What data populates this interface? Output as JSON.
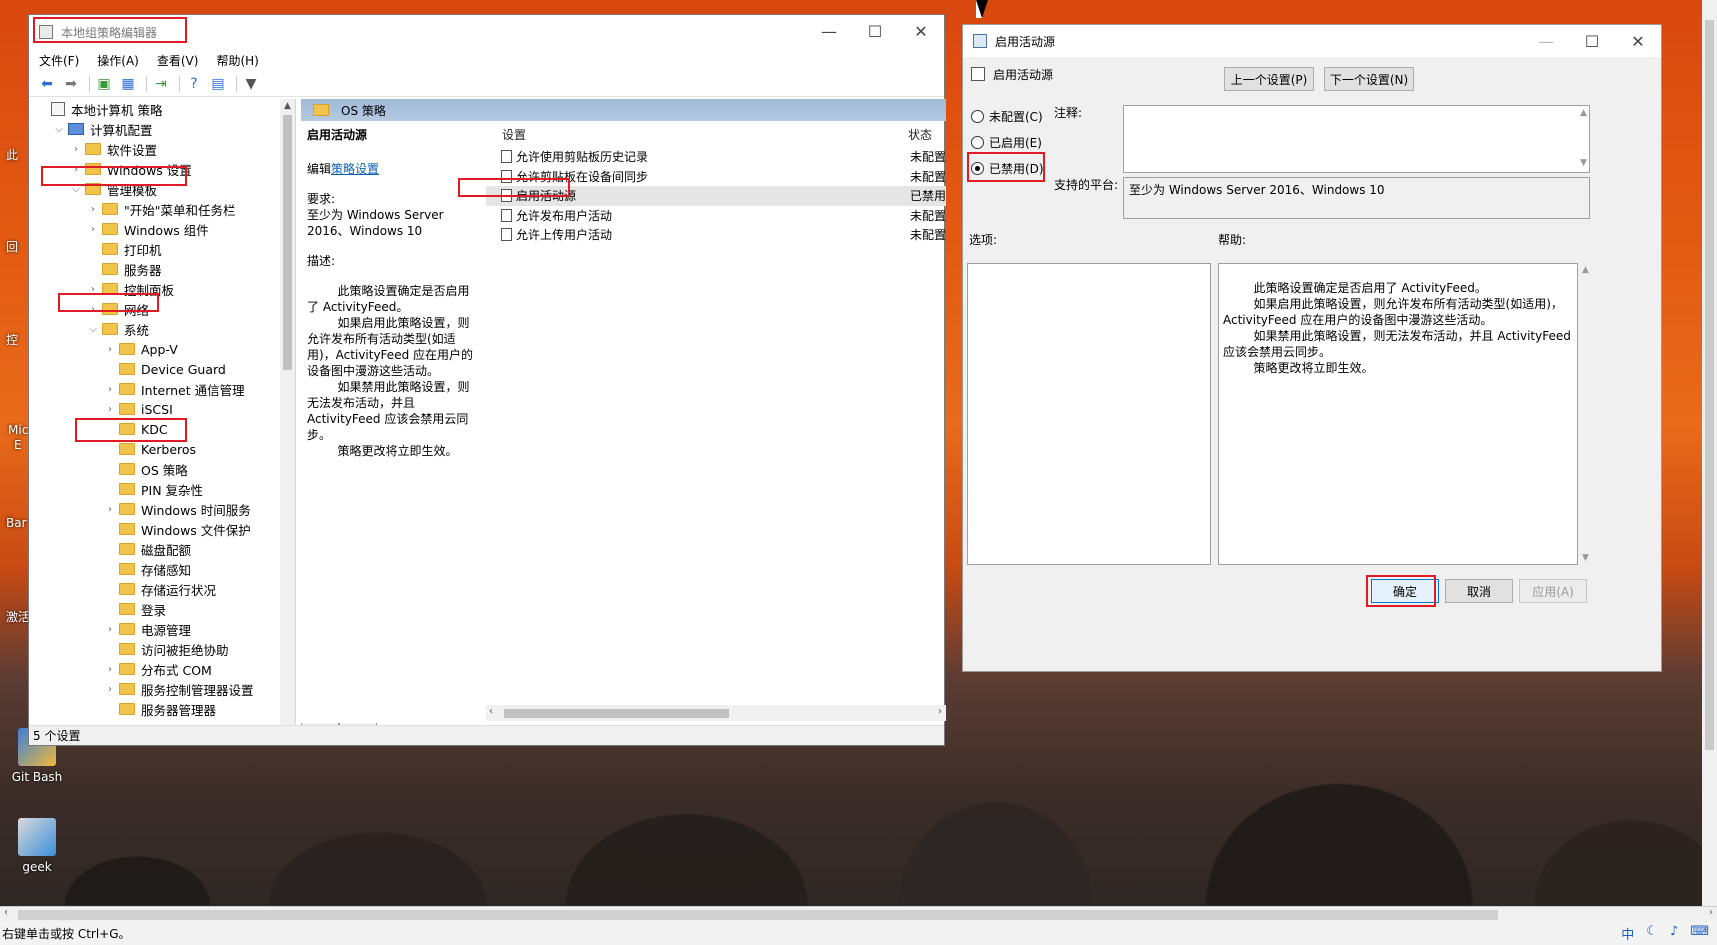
{
  "gpedit": {
    "title": "本地组策略编辑器",
    "menu": [
      "文件(F)",
      "操作(A)",
      "查看(V)",
      "帮助(H)"
    ],
    "tree": [
      {
        "label": "本地计算机 策略",
        "indent": 0,
        "icon": "doc",
        "twisty": ""
      },
      {
        "label": "计算机配置",
        "indent": 1,
        "icon": "pc",
        "twisty": "v"
      },
      {
        "label": "软件设置",
        "indent": 2,
        "icon": "folder",
        "twisty": ">"
      },
      {
        "label": "Windows 设置",
        "indent": 2,
        "icon": "folder",
        "twisty": ">"
      },
      {
        "label": "管理模板",
        "indent": 2,
        "icon": "folder",
        "twisty": "v"
      },
      {
        "label": "\"开始\"菜单和任务栏",
        "indent": 3,
        "icon": "folder",
        "twisty": ">"
      },
      {
        "label": "Windows 组件",
        "indent": 3,
        "icon": "folder",
        "twisty": ">"
      },
      {
        "label": "打印机",
        "indent": 3,
        "icon": "folder",
        "twisty": ""
      },
      {
        "label": "服务器",
        "indent": 3,
        "icon": "folder",
        "twisty": ""
      },
      {
        "label": "控制面板",
        "indent": 3,
        "icon": "folder",
        "twisty": ">"
      },
      {
        "label": "网络",
        "indent": 3,
        "icon": "folder",
        "twisty": ">"
      },
      {
        "label": "系统",
        "indent": 3,
        "icon": "folder",
        "twisty": "v"
      },
      {
        "label": "App-V",
        "indent": 4,
        "icon": "folder",
        "twisty": ">"
      },
      {
        "label": "Device Guard",
        "indent": 4,
        "icon": "folder",
        "twisty": ""
      },
      {
        "label": "Internet 通信管理",
        "indent": 4,
        "icon": "folder",
        "twisty": ">"
      },
      {
        "label": "iSCSI",
        "indent": 4,
        "icon": "folder",
        "twisty": ">"
      },
      {
        "label": "KDC",
        "indent": 4,
        "icon": "folder",
        "twisty": ""
      },
      {
        "label": "Kerberos",
        "indent": 4,
        "icon": "folder",
        "twisty": ""
      },
      {
        "label": "OS 策略",
        "indent": 4,
        "icon": "folder",
        "twisty": ""
      },
      {
        "label": "PIN 复杂性",
        "indent": 4,
        "icon": "folder",
        "twisty": ""
      },
      {
        "label": "Windows 时间服务",
        "indent": 4,
        "icon": "folder",
        "twisty": ">"
      },
      {
        "label": "Windows 文件保护",
        "indent": 4,
        "icon": "folder",
        "twisty": ""
      },
      {
        "label": "磁盘配额",
        "indent": 4,
        "icon": "folder",
        "twisty": ""
      },
      {
        "label": "存储感知",
        "indent": 4,
        "icon": "folder",
        "twisty": ""
      },
      {
        "label": "存储运行状况",
        "indent": 4,
        "icon": "folder",
        "twisty": ""
      },
      {
        "label": "登录",
        "indent": 4,
        "icon": "folder",
        "twisty": ""
      },
      {
        "label": "电源管理",
        "indent": 4,
        "icon": "folder",
        "twisty": ">"
      },
      {
        "label": "访问被拒绝协助",
        "indent": 4,
        "icon": "folder",
        "twisty": ""
      },
      {
        "label": "分布式 COM",
        "indent": 4,
        "icon": "folder",
        "twisty": ">"
      },
      {
        "label": "服务控制管理器设置",
        "indent": 4,
        "icon": "folder",
        "twisty": ">"
      },
      {
        "label": "服务器管理器",
        "indent": 4,
        "icon": "folder",
        "twisty": ""
      }
    ],
    "breadcrumb": "OS 策略",
    "desc": {
      "heading": "启用活动源",
      "edit_prefix": "编辑",
      "edit_link": "策略设置",
      "req_label": "要求:",
      "req_text": "至少为 Windows Server 2016、Windows 10",
      "desc_label": "描述:",
      "p1": "        此策略设置确定是否启用了 ActivityFeed。",
      "p2": "        如果启用此策略设置，则允许发布所有活动类型(如适用)，ActivityFeed 应在用户的设备图中漫游这些活动。",
      "p3": "        如果禁用此策略设置，则无法发布活动，并且 ActivityFeed 应该会禁用云同步。",
      "p4": "        策略更改将立即生效。"
    },
    "columns": {
      "setting": "设置",
      "state": "状态"
    },
    "settings": [
      {
        "name": "允许使用剪贴板历史记录",
        "state": "未配置"
      },
      {
        "name": "允许剪贴板在设备间同步",
        "state": "未配置"
      },
      {
        "name": "启用活动源",
        "state": "已禁用"
      },
      {
        "name": "允许发布用户活动",
        "state": "未配置"
      },
      {
        "name": "允许上传用户活动",
        "state": "未配置"
      }
    ],
    "tabs": [
      "扩展",
      "标准"
    ],
    "status": "5 个设置"
  },
  "dialog": {
    "title": "启用活动源",
    "subtitle": "启用活动源",
    "prev": "上一个设置(P)",
    "next": "下一个设置(N)",
    "radio_not_configured": "未配置(C)",
    "radio_enabled": "已启用(E)",
    "radio_disabled": "已禁用(D)",
    "selected": "disabled",
    "comment_label": "注释:",
    "platform_label": "支持的平台:",
    "platform_value": "至少为 Windows Server 2016、Windows 10",
    "options_label": "选项:",
    "help_label": "帮助:",
    "help_text": "        此策略设置确定是否启用了 ActivityFeed。\n        如果启用此策略设置，则允许发布所有活动类型(如适用)，ActivityFeed 应在用户的设备图中漫游这些活动。\n        如果禁用此策略设置，则无法发布活动，并且 ActivityFeed 应该会禁用云同步。\n        策略更改将立即生效。",
    "ok": "确定",
    "cancel": "取消",
    "apply": "应用(A)"
  },
  "desktop": {
    "icons": [
      {
        "label": "Git Bash"
      },
      {
        "label": "geek"
      }
    ],
    "fragments": [
      "此",
      "回",
      "控",
      "Mic",
      "E",
      "Bar",
      "激活"
    ]
  },
  "taskbar": {
    "hint": "右键单击或按 Ctrl+G。",
    "tray": [
      "中",
      "☾",
      "♪",
      "⌨"
    ]
  },
  "colors": {
    "highlight": "#e01b24",
    "accent": "#0b5fb5"
  }
}
